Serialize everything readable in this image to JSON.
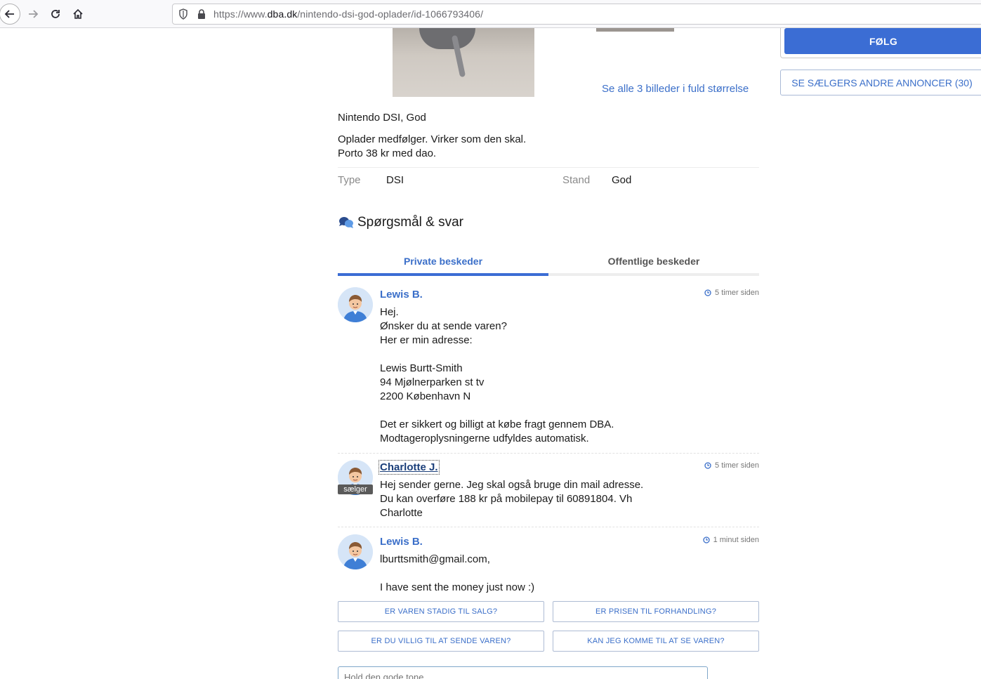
{
  "browser": {
    "url_prefix": "https://www.",
    "url_domain": "dba.dk",
    "url_path": "/nintendo-dsi-god-oplader/id-1066793406/"
  },
  "gallery": {
    "see_all_label": "Se alle 3 billeder i fuld størrelse"
  },
  "seller_panel": {
    "follow_label": "FØLG",
    "other_ads_label": "SE SÆLGERS ANDRE ANNONCER (30)"
  },
  "listing": {
    "title": "Nintendo DSI, God",
    "description": "Oplader medfølger. Virker som den skal.\nPorto 38 kr med dao.",
    "attributes": [
      {
        "label": "Type",
        "value": "DSI"
      },
      {
        "label": "Stand",
        "value": "God"
      }
    ]
  },
  "qa": {
    "heading": "Spørgsmål & svar",
    "tabs": [
      {
        "label": "Private beskeder",
        "active": true
      },
      {
        "label": "Offentlige beskeder",
        "active": false
      }
    ],
    "messages": [
      {
        "author": "Lewis B.",
        "time": "5 timer siden",
        "body": "Hej.\nØnsker du at sende varen?\nHer er min adresse:\n\nLewis Burtt-Smith\n94 Mjølnerparken st tv\n2200 København N\n\nDet er sikkert og billigt at købe fragt gennem DBA.\nModtageroplysningerne udfyldes automatisk."
      },
      {
        "author": "Charlotte J.",
        "time": "5 timer siden",
        "badge": "sælger",
        "body": "Hej sender gerne. Jeg skal også bruge din mail adresse.\nDu kan overføre 188 kr på mobilepay til 60891804. Vh\nCharlotte"
      },
      {
        "author": "Lewis B.",
        "time": "1 minut siden",
        "body": "lburttsmith@gmail.com,\n\nI have sent the money just now :)"
      }
    ],
    "quick_replies": [
      "ER VAREN STADIG TIL SALG?",
      "ER PRISEN TIL FORHANDLING?",
      "ER DU VILLIG TIL AT SENDE VAREN?",
      "KAN JEG KOMME TIL AT SE VAREN?"
    ],
    "reply_placeholder": "Hold den gode tone"
  },
  "colors": {
    "accent": "#3b6dd4",
    "link": "#3b6fc9"
  }
}
